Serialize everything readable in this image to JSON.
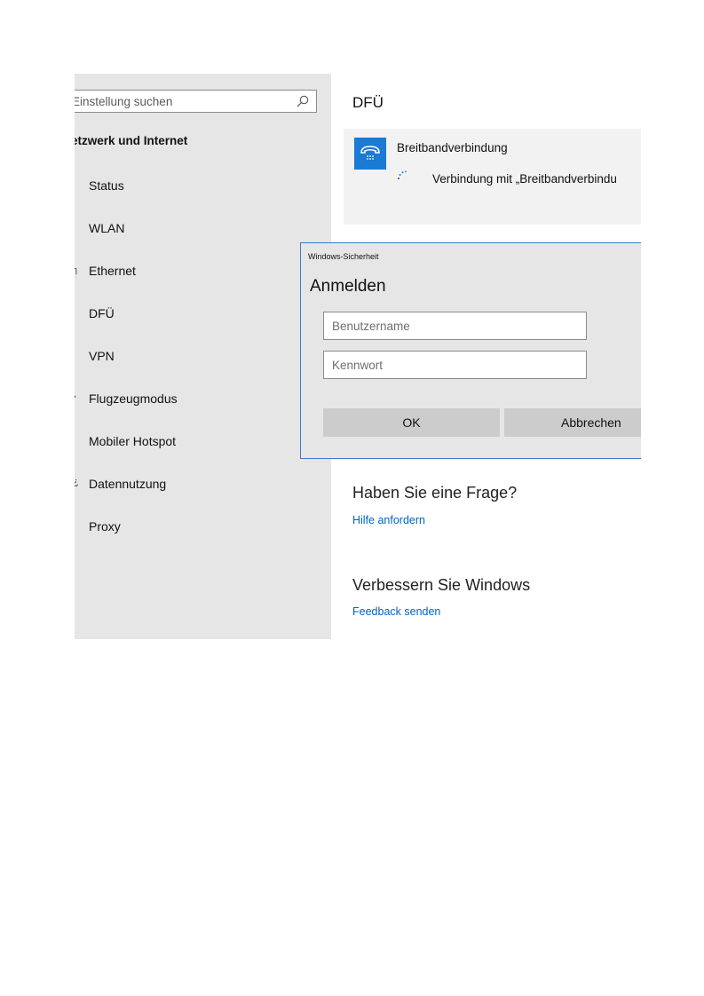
{
  "sidebar": {
    "search_placeholder": "Einstellung suchen",
    "header": "etzwerk und Internet",
    "items": [
      {
        "icon": "status-icon",
        "glyph": "ʼ",
        "label": "Status"
      },
      {
        "icon": "wlan-icon",
        "glyph": "¦",
        "label": "WLAN"
      },
      {
        "icon": "ethernet-icon",
        "glyph": "┐",
        "label": "Ethernet"
      },
      {
        "icon": "dialup-icon",
        "glyph": "ʼ",
        "label": "DFÜ"
      },
      {
        "icon": "vpn-icon",
        "glyph": "ʼ",
        "label": "VPN"
      },
      {
        "icon": "airplane-icon",
        "glyph": "›",
        "label": "Flugzeugmodus"
      },
      {
        "icon": "hotspot-icon",
        "glyph": "ʼ",
        "label": "Mobiler Hotspot"
      },
      {
        "icon": "data-usage-icon",
        "glyph": "¿",
        "label": "Datennutzung"
      },
      {
        "icon": "proxy-icon",
        "glyph": "ʼ",
        "label": "Proxy"
      }
    ]
  },
  "main": {
    "title": "DFÜ",
    "connection": {
      "name": "Breitbandverbindung",
      "status": "Verbindung mit „Breitbandverbindu"
    },
    "question_title": "Haben Sie eine Frage?",
    "help_link": "Hilfe anfordern",
    "improve_title": "Verbessern Sie Windows",
    "feedback_link": "Feedback senden"
  },
  "dialog": {
    "caption": "Windows-Sicherheit",
    "title": "Anmelden",
    "username_placeholder": "Benutzername",
    "username_value": "",
    "password_placeholder": "Kennwort",
    "password_value": "",
    "ok_label": "OK",
    "cancel_label": "Abbrechen"
  },
  "colors": {
    "accent": "#1a7ad4",
    "link": "#0064c8",
    "dialog_border": "#3a7ec8",
    "sidebar_bg": "#e6e6e6",
    "button_bg": "#cccccc"
  }
}
